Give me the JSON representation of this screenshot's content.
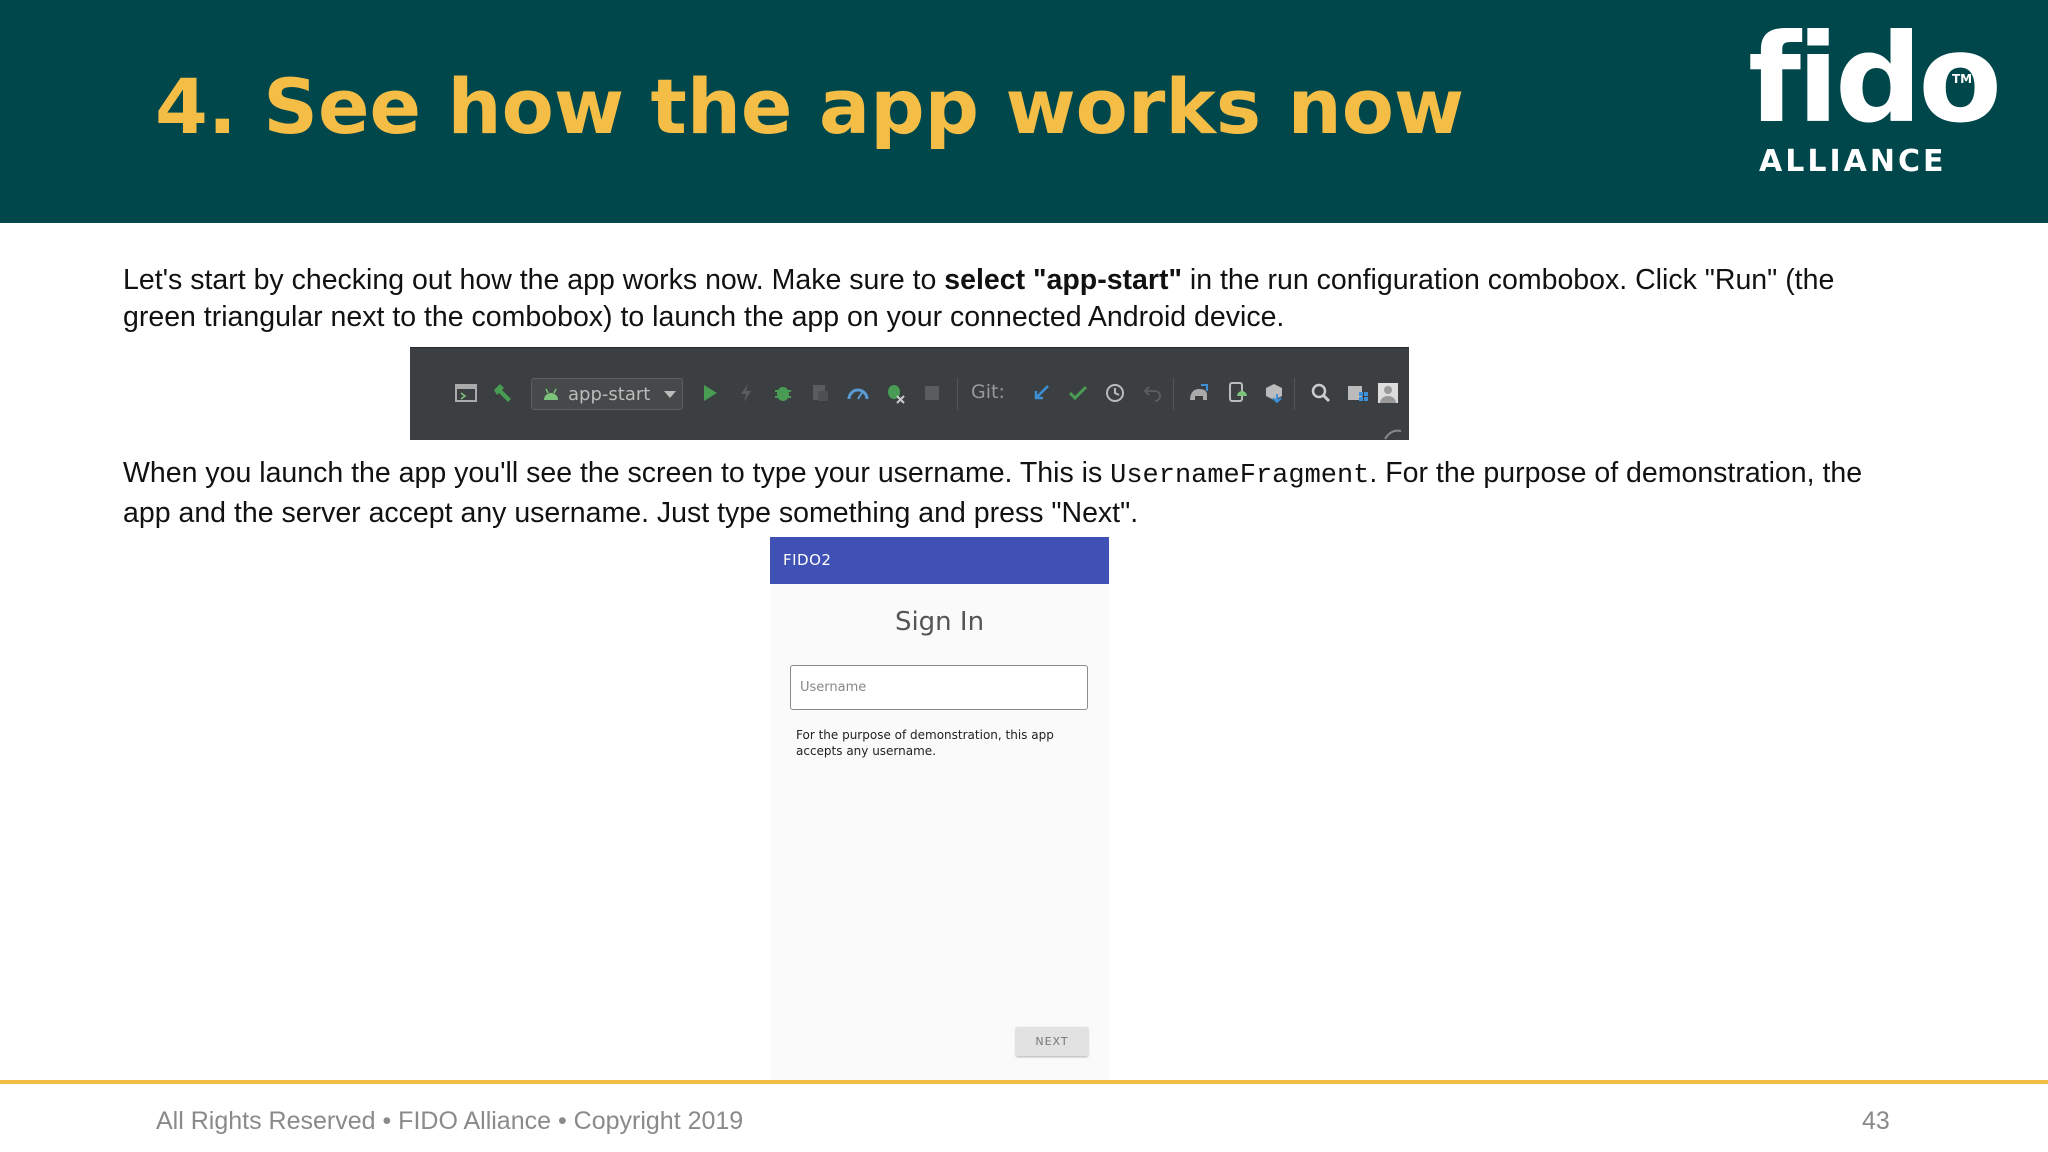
{
  "slide": {
    "title": "4. See how the app works now",
    "logo": {
      "word": "fido",
      "tm": "TM",
      "sub": "ALLIANCE"
    },
    "para1": {
      "before": "Let's start by checking out how the app works now. Make sure to ",
      "bold": "select \"app-start\"",
      "after": " in the run configuration combobox. Click \"Run\" (the green triangular next to the combobox) to launch the app on your connected Android device."
    },
    "para2": {
      "before": "When you launch the app you'll see the screen to type your username. This is ",
      "code": "UsernameFragment",
      "after": ". For the purpose of demonstration, the app and the server accept any username. Just type something and press \"Next\"."
    },
    "footer": {
      "text": "All Rights Reserved • FIDO Alliance • Copyright 2019",
      "page": "43"
    }
  },
  "toolbar": {
    "run_config": "app-start",
    "git_label": "Git:",
    "icons": [
      "window-icon",
      "build-hammer-icon",
      "android-icon",
      "run-icon",
      "apply-changes-icon",
      "debug-icon",
      "coverage-icon",
      "profile-icon",
      "attach-debugger-icon",
      "stop-icon",
      "git-update-icon",
      "git-commit-icon",
      "git-history-icon",
      "git-rollback-icon",
      "sync-gradle-icon",
      "avd-manager-icon",
      "sdk-manager-icon",
      "search-icon",
      "project-structure-icon",
      "user-avatar-icon"
    ]
  },
  "phone": {
    "app_title": "FIDO2",
    "heading": "Sign In",
    "username_placeholder": "Username",
    "hint": "For the purpose of demonstration, this app accepts any username.",
    "next_label": "NEXT"
  },
  "colors": {
    "header_bg": "#00474c",
    "title_gold": "#f4bd45",
    "appbar_indigo": "#3f51b5",
    "toolbar_bg": "#3c3f41",
    "run_green": "#499c54"
  }
}
